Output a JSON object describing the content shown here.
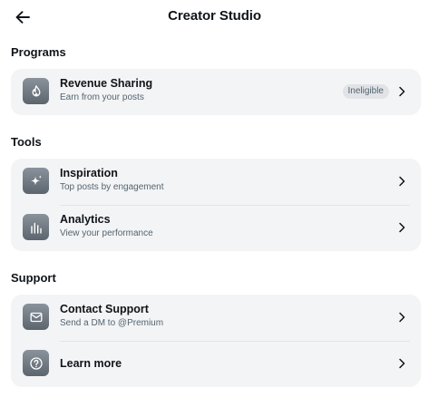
{
  "header": {
    "title": "Creator Studio",
    "back_icon": "arrow-left-icon"
  },
  "sections": {
    "programs": {
      "label": "Programs",
      "items": [
        {
          "title": "Revenue Sharing",
          "subtitle": "Earn from your posts",
          "badge": "Ineligible",
          "icon": "flame-icon"
        }
      ]
    },
    "tools": {
      "label": "Tools",
      "items": [
        {
          "title": "Inspiration",
          "subtitle": "Top posts by engagement",
          "icon": "sparkle-icon"
        },
        {
          "title": "Analytics",
          "subtitle": "View your performance",
          "icon": "bar-chart-icon"
        }
      ]
    },
    "support": {
      "label": "Support",
      "items": [
        {
          "title": "Contact Support",
          "subtitle": "Send a DM to @Premium",
          "icon": "mail-icon"
        },
        {
          "title": "Learn more",
          "icon": "help-circle-icon"
        }
      ]
    }
  },
  "colors": {
    "card_background": "#f3f4f5",
    "icon_tile": "#6b747d",
    "primary_text": "#0f1419",
    "secondary_text": "#536471"
  }
}
